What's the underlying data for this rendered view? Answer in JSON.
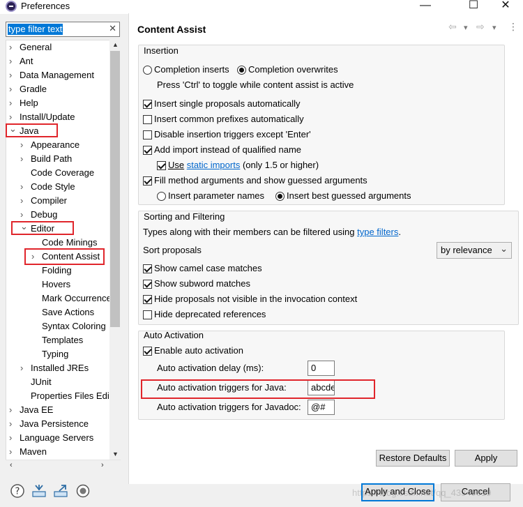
{
  "window": {
    "title": "Preferences",
    "controls": [
      "—",
      "☐",
      "✕"
    ]
  },
  "filter": {
    "value": "type filter text",
    "clear": "✕"
  },
  "tree": [
    {
      "label": "General",
      "twisty": "›"
    },
    {
      "label": "Ant",
      "twisty": "›"
    },
    {
      "label": "Data Management",
      "twisty": "›"
    },
    {
      "label": "Gradle",
      "twisty": "›"
    },
    {
      "label": "Help",
      "twisty": "›"
    },
    {
      "label": "Install/Update",
      "twisty": "›"
    },
    {
      "label": "Java",
      "twisty": "⌄"
    },
    {
      "label": "Appearance",
      "twisty": "›"
    },
    {
      "label": "Build Path",
      "twisty": "›"
    },
    {
      "label": "Code Coverage",
      "twisty": ""
    },
    {
      "label": "Code Style",
      "twisty": "›"
    },
    {
      "label": "Compiler",
      "twisty": "›"
    },
    {
      "label": "Debug",
      "twisty": "›"
    },
    {
      "label": "Editor",
      "twisty": "⌄"
    },
    {
      "label": "Code Minings",
      "twisty": ""
    },
    {
      "label": "Content Assist",
      "twisty": "›"
    },
    {
      "label": "Folding",
      "twisty": ""
    },
    {
      "label": "Hovers",
      "twisty": ""
    },
    {
      "label": "Mark Occurrence",
      "twisty": ""
    },
    {
      "label": "Save Actions",
      "twisty": ""
    },
    {
      "label": "Syntax Coloring",
      "twisty": ""
    },
    {
      "label": "Templates",
      "twisty": ""
    },
    {
      "label": "Typing",
      "twisty": ""
    },
    {
      "label": "Installed JREs",
      "twisty": "›"
    },
    {
      "label": "JUnit",
      "twisty": ""
    },
    {
      "label": "Properties Files Edi",
      "twisty": ""
    },
    {
      "label": "Java EE",
      "twisty": "›"
    },
    {
      "label": "Java Persistence",
      "twisty": "›"
    },
    {
      "label": "Language Servers",
      "twisty": "›"
    },
    {
      "label": "Maven",
      "twisty": "›"
    }
  ],
  "page": {
    "title": "Content Assist",
    "nav": {
      "back": "⇦",
      "back_menu": "▾",
      "forward": "⇨",
      "forward_menu": "▾",
      "menu": "⋮"
    }
  },
  "insertion": {
    "group_label": "Insertion",
    "radio_inserts": "Completion inserts",
    "radio_overwrites": "Completion overwrites",
    "toggle_hint": "Press 'Ctrl' to toggle while content assist is active",
    "insert_single": "Insert single proposals automatically",
    "insert_common": "Insert common prefixes automatically",
    "disable_triggers": "Disable insertion triggers except 'Enter'",
    "add_import": "Add import instead of qualified name",
    "use_prefix": "Use",
    "static_imports_link": "static imports",
    "use_suffix": "(only 1.5 or higher)",
    "fill_method": "Fill method arguments and show guessed arguments",
    "insert_param_names": "Insert parameter names",
    "insert_best_guessed": "Insert best guessed arguments",
    "state": {
      "completion_mode": "overwrites",
      "insert_single": true,
      "insert_common": false,
      "disable_triggers": false,
      "add_import": true,
      "use_static": true,
      "fill_method": true,
      "argument_mode": "best_guessed"
    }
  },
  "sorting": {
    "group_label": "Sorting and Filtering",
    "types_text_prefix": "Types along with their members can be filtered using",
    "type_filters_link": "type filters",
    "types_text_suffix": ".",
    "sort_label": "Sort proposals",
    "sort_value": "by relevance",
    "sort_arrow": "⌄",
    "camel_case": "Show camel case matches",
    "subword": "Show subword matches",
    "hide_not_visible": "Hide proposals not visible in the invocation context",
    "hide_deprecated": "Hide deprecated references",
    "state": {
      "camel_case": true,
      "subword": true,
      "hide_not_visible": true,
      "hide_deprecated": false
    }
  },
  "auto": {
    "group_label": "Auto Activation",
    "enable": "Enable auto activation",
    "delay_label": "Auto activation delay (ms):",
    "delay_value": "0",
    "java_triggers_label": "Auto activation triggers for Java:",
    "java_triggers_value": "abcde",
    "javadoc_triggers_label": "Auto activation triggers for Javadoc:",
    "javadoc_triggers_value": "@#",
    "state": {
      "enable": true
    }
  },
  "buttons": {
    "restore_defaults": "Restore Defaults",
    "apply": "Apply",
    "apply_and_close": "Apply and Close",
    "cancel": "Cancel"
  },
  "bottom_icons": [
    "help-icon",
    "import-icon",
    "export-icon",
    "record-icon"
  ],
  "watermark": "https://blog.csdn.net/qq_43349019",
  "colors": {
    "highlight_box": "#e0252b",
    "selection": "#0078d7",
    "link": "#0066cc"
  }
}
